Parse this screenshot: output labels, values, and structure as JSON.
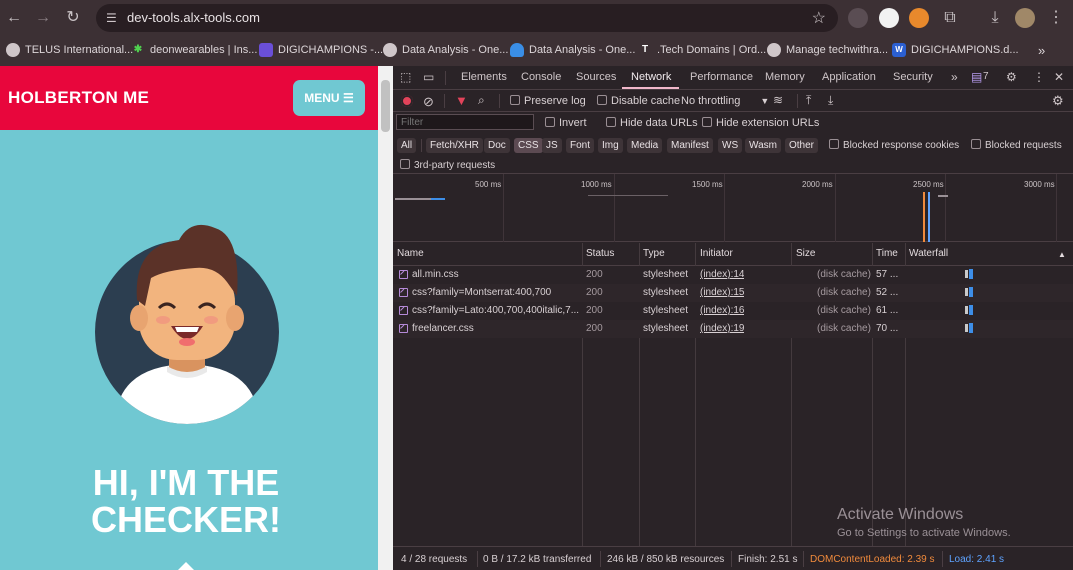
{
  "browser": {
    "url": "dev-tools.alx-tools.com",
    "bookmarks": [
      {
        "label": "TELUS International..."
      },
      {
        "label": "deonwearables | Ins..."
      },
      {
        "label": "DIGICHAMPIONS -..."
      },
      {
        "label": "Data Analysis - One..."
      },
      {
        "label": "Data Analysis - One..."
      },
      {
        "label": ".Tech Domains | Ord..."
      },
      {
        "label": "Manage techwithra..."
      },
      {
        "label": "DIGICHAMPIONS.d..."
      }
    ]
  },
  "site": {
    "logo": "HOLBERTON ME",
    "menu_label": "MENU",
    "hero_line1": "HI, I'M THE",
    "hero_line2": "CHECKER!"
  },
  "devtools": {
    "tabs": [
      "Elements",
      "Console",
      "Sources",
      "Network",
      "Performance",
      "Memory",
      "Application",
      "Security"
    ],
    "active_tab": "Network",
    "issues_count": "7",
    "toolbar": {
      "preserve_log": "Preserve log",
      "disable_cache": "Disable cache",
      "throttling": "No throttling"
    },
    "filter": {
      "placeholder": "Filter",
      "invert": "Invert",
      "hide_data_urls": "Hide data URLs",
      "hide_extension_urls": "Hide extension URLs"
    },
    "types": [
      "All",
      "Fetch/XHR",
      "Doc",
      "CSS",
      "JS",
      "Font",
      "Img",
      "Media",
      "Manifest",
      "WS",
      "Wasm",
      "Other"
    ],
    "active_type": "CSS",
    "blocked_response_cookies": "Blocked response cookies",
    "blocked_requests": "Blocked requests",
    "third_party": "3rd-party requests",
    "timeline_ticks": [
      "500 ms",
      "1000 ms",
      "1500 ms",
      "2000 ms",
      "2500 ms",
      "3000 ms"
    ],
    "columns": [
      "Name",
      "Status",
      "Type",
      "Initiator",
      "Size",
      "Time",
      "Waterfall"
    ],
    "rows": [
      {
        "name": "all.min.css",
        "status": "200",
        "type": "stylesheet",
        "initiator": "(index):14",
        "size": "(disk cache)",
        "time": "57 ..."
      },
      {
        "name": "css?family=Montserrat:400,700",
        "status": "200",
        "type": "stylesheet",
        "initiator": "(index):15",
        "size": "(disk cache)",
        "time": "52 ..."
      },
      {
        "name": "css?family=Lato:400,700,400italic,7...",
        "status": "200",
        "type": "stylesheet",
        "initiator": "(index):16",
        "size": "(disk cache)",
        "time": "61 ..."
      },
      {
        "name": "freelancer.css",
        "status": "200",
        "type": "stylesheet",
        "initiator": "(index):19",
        "size": "(disk cache)",
        "time": "70 ..."
      }
    ],
    "status_bar": {
      "requests": "4 / 28 requests",
      "transferred": "0 B / 17.2 kB transferred",
      "resources": "246 kB / 850 kB resources",
      "finish": "Finish: 2.51 s",
      "dom_content_loaded": "DOMContentLoaded: 2.39 s",
      "load": "Load: 2.41 s"
    },
    "watermark": {
      "title": "Activate Windows",
      "subtitle": "Go to Settings to activate Windows."
    }
  },
  "colors": {
    "site_header": "#e8063c",
    "site_bg": "#70c8d2",
    "dcl": "#f08a3c",
    "load": "#5ea3ff"
  }
}
